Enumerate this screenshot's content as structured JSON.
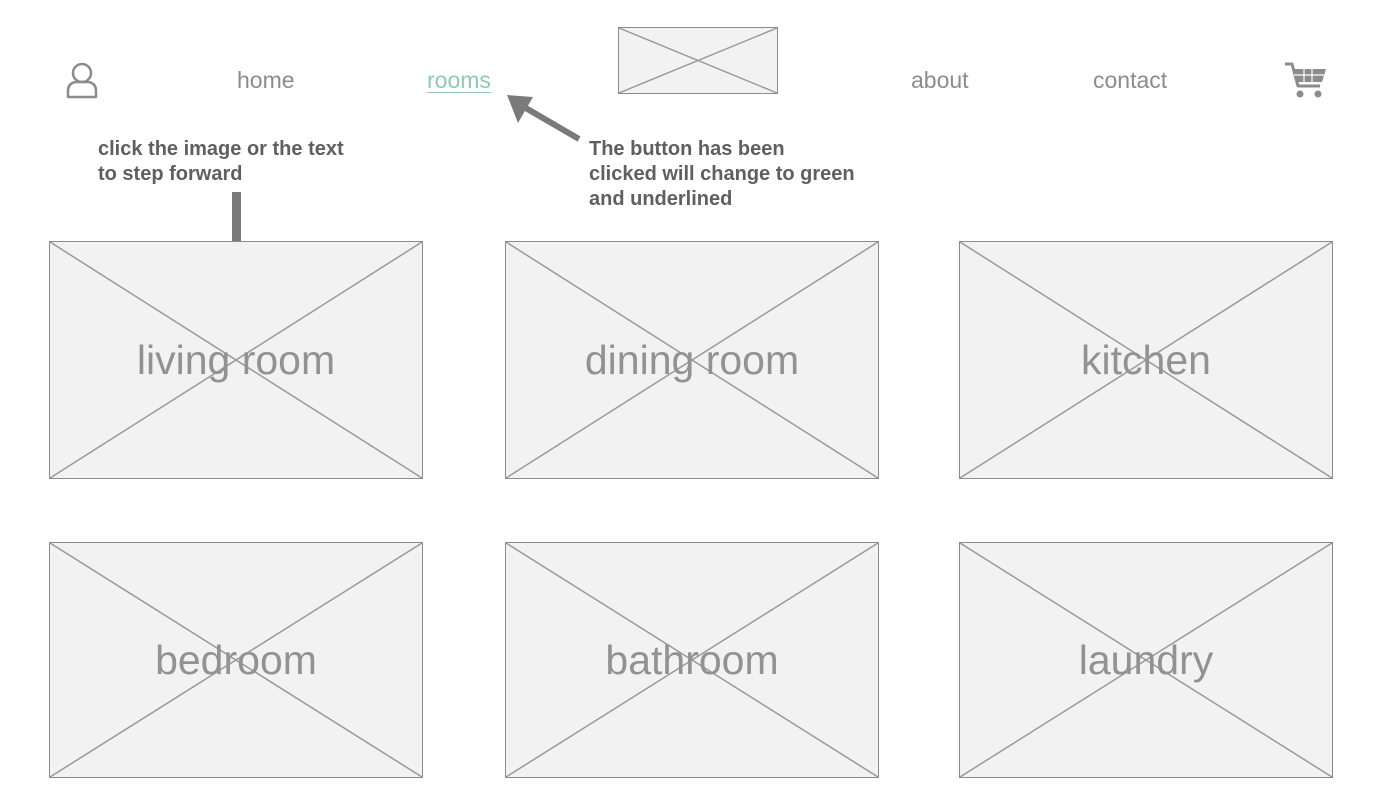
{
  "nav": {
    "user_icon": "user-icon",
    "home_label": "home",
    "rooms_label": "rooms",
    "logo_icon": "logo-placeholder",
    "about_label": "about",
    "contact_label": "contact",
    "cart_icon": "cart-icon",
    "active_color": "#8fc9b4",
    "link_color": "#8c8c8c"
  },
  "annotations": {
    "step_forward_note": "click the image or the text\nto step forward",
    "button_clicked_note": "The button has been\nclicked will change to green\nand underlined",
    "arrow_color": "#7a7a7a"
  },
  "rooms": [
    {
      "label": "living room"
    },
    {
      "label": "dining room"
    },
    {
      "label": "kitchen"
    },
    {
      "label": "bedroom"
    },
    {
      "label": "bathroom"
    },
    {
      "label": "laundry"
    }
  ]
}
